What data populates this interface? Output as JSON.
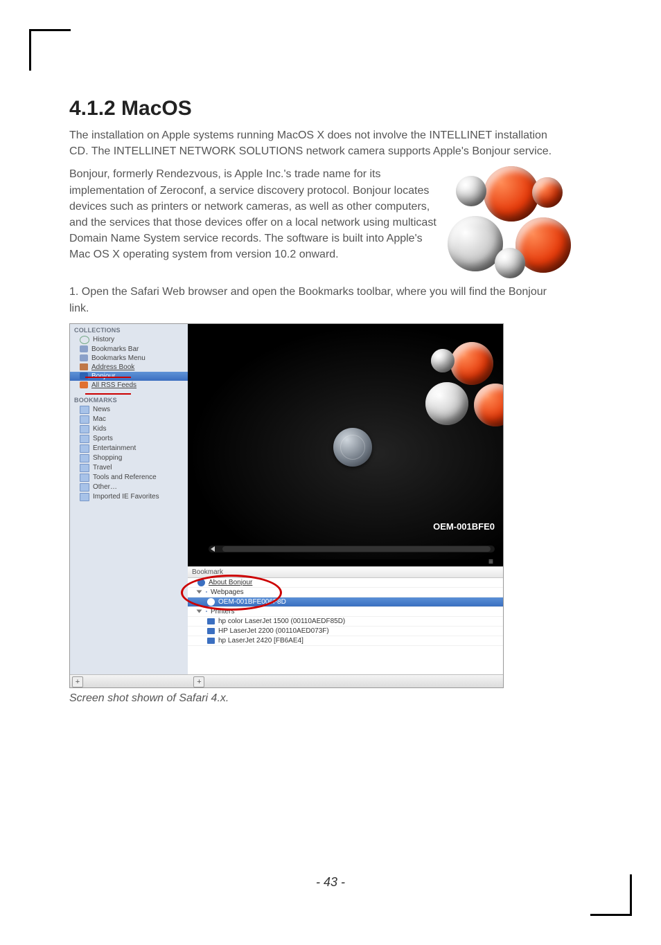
{
  "heading": "4.1.2 MacOS",
  "para1": "The installation on Apple systems running MacOS X does not involve the INTELLINET installation CD. The INTELLINET NETWORK SOLUTIONS network camera supports Apple's Bonjour service.",
  "para2": "Bonjour, formerly Rendezvous, is Apple Inc.'s trade name for its implementation of Zeroconf, a service discovery protocol. Bonjour locates devices such as printers or network cameras, as well as other computers, and the services that those devices offer on a local network using multicast Domain Name System service records. The software is built into Apple's Mac OS X operating system from version 10.2 onward.",
  "step1": "1. Open the Safari Web browser and open the Bookmarks toolbar, where you will find the Bonjour link.",
  "sidebar": {
    "head1": "COLLECTIONS",
    "items1": [
      "History",
      "Bookmarks Bar",
      "Bookmarks Menu",
      "Address Book",
      "Bonjour",
      "All RSS Feeds"
    ],
    "head2": "BOOKMARKS",
    "items2": [
      "News",
      "Mac",
      "Kids",
      "Sports",
      "Entertainment",
      "Shopping",
      "Travel",
      "Tools and Reference",
      "Other…",
      "Imported IE Favorites"
    ]
  },
  "preview": {
    "oem_label": "OEM-001BFE0"
  },
  "list": {
    "header": "Bookmark",
    "about": "About Bonjour",
    "webpages": "Webpages",
    "selected": "OEM-001BFE006F8D",
    "printers": "Printers",
    "printer_items": [
      "hp color LaserJet 1500 (00110AEDF85D)",
      "HP LaserJet 2200 (00110AED073F)",
      "hp LaserJet 2420 [FB6AE4]"
    ]
  },
  "caption": "Screen shot shown of Safari 4.x.",
  "page_number": "- 43 -"
}
